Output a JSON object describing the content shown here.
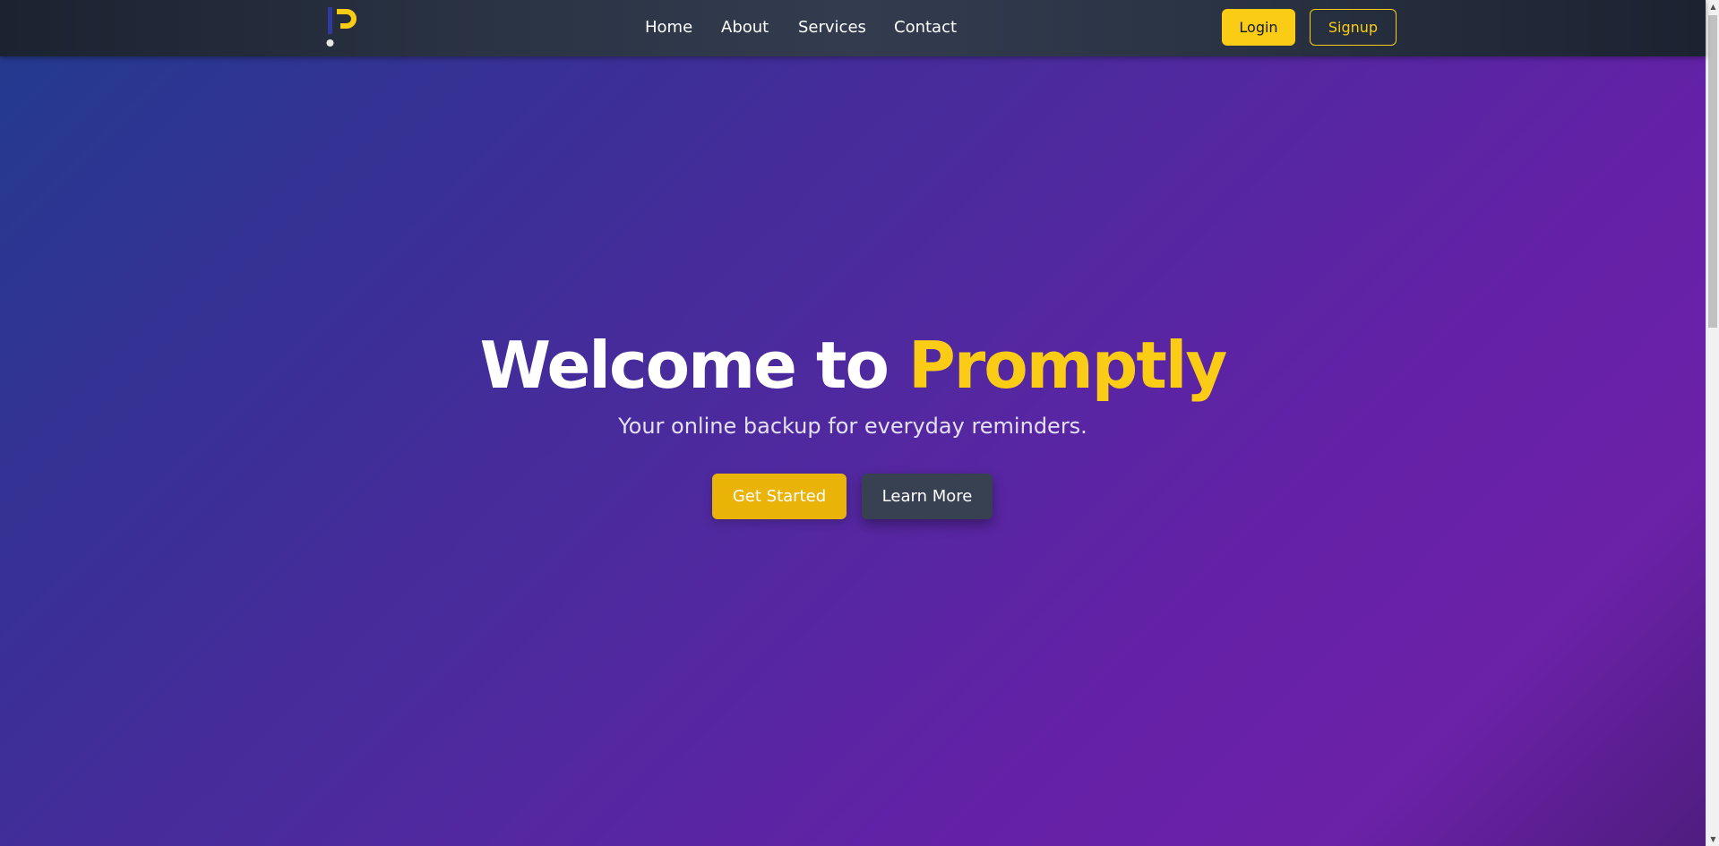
{
  "nav": {
    "logo_icon": "promptly-p-logo",
    "links": [
      "Home",
      "About",
      "Services",
      "Contact"
    ],
    "login_label": "Login",
    "signup_label": "Signup"
  },
  "hero": {
    "title_part1": "Welcome to",
    "title_part2": "Promptly",
    "subtitle": "Your online backup for everyday reminders.",
    "primary_button": "Get Started",
    "secondary_button": "Learn More"
  },
  "colors": {
    "accent": "#facc15",
    "navbar_bg": "#2b3445",
    "hero_gradient_start": "#243a8f",
    "hero_gradient_end": "#6b21a8",
    "learn_more_bg": "#374151"
  }
}
